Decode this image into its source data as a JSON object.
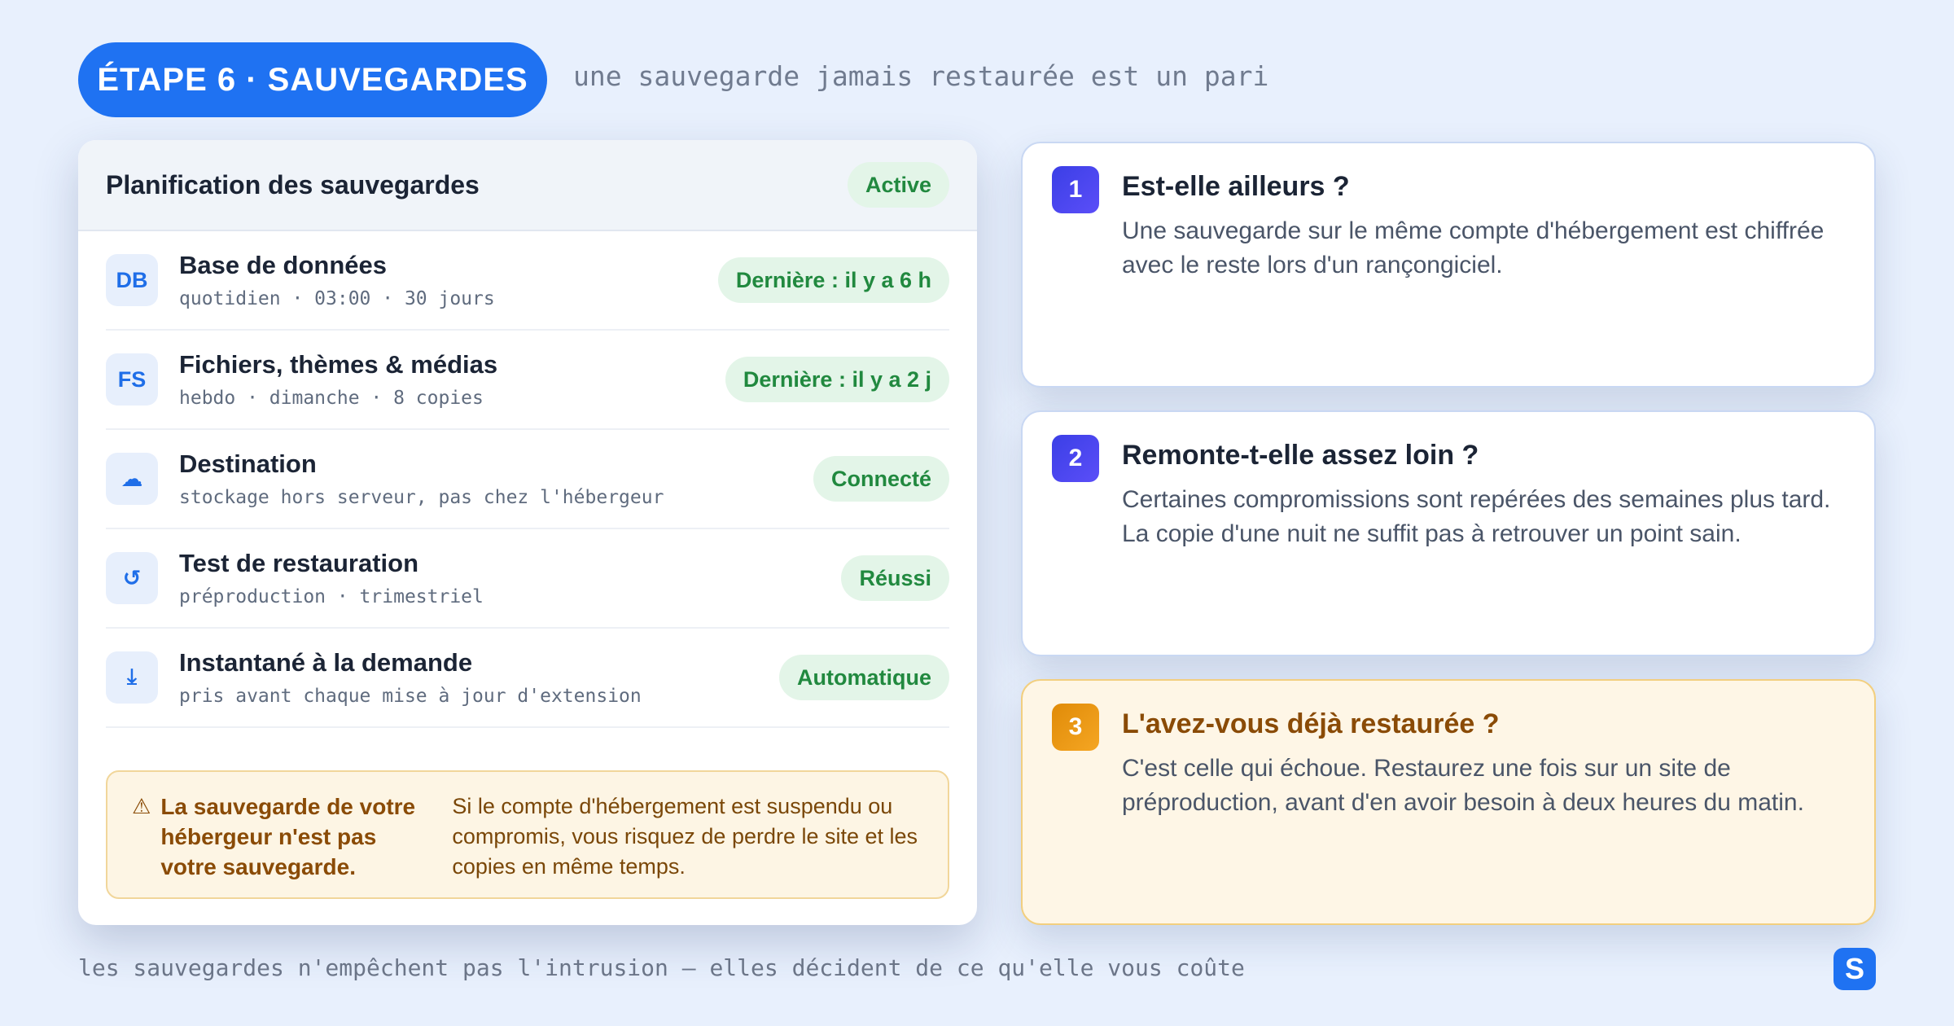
{
  "header": {
    "step_label": "ÉTAPE 6 · SAUVEGARDES",
    "tagline": "une sauvegarde jamais restaurée est un pari"
  },
  "schedule": {
    "title": "Planification des sauvegardes",
    "status": "Active",
    "rows": [
      {
        "icon": "DB",
        "icon_name": "database-icon",
        "title": "Base de données",
        "detail": "quotidien · 03:00 · 30 jours",
        "status": "Dernière : il y a 6 h"
      },
      {
        "icon": "FS",
        "icon_name": "files-icon",
        "title": "Fichiers, thèmes & médias",
        "detail": "hebdo · dimanche · 8 copies",
        "status": "Dernière : il y a 2 j"
      },
      {
        "icon": "☁",
        "icon_name": "cloud-icon",
        "title": "Destination",
        "detail": "stockage hors serveur, pas chez l'hébergeur",
        "status": "Connecté"
      },
      {
        "icon": "↺",
        "icon_name": "restore-icon",
        "title": "Test de restauration",
        "detail": "préproduction · trimestriel",
        "status": "Réussi"
      },
      {
        "icon": "⤓",
        "icon_name": "download-icon",
        "title": "Instantané à la demande",
        "detail": "pris avant chaque mise à jour d'extension",
        "status": "Automatique"
      }
    ],
    "warning": {
      "icon": "⚠",
      "title": "La sauvegarde de votre hébergeur n'est pas votre sauvegarde.",
      "body": "Si le compte d'hébergement est suspendu ou compromis, vous risquez de perdre le site et les copies en même temps."
    }
  },
  "questions": [
    {
      "number": "1",
      "title": "Est-elle ailleurs ?",
      "body": "Une sauvegarde sur le même compte d'hébergement est chiffrée avec le reste lors d'un rançongiciel."
    },
    {
      "number": "2",
      "title": "Remonte-t-elle assez loin ?",
      "body": "Certaines compromissions sont repérées des semaines plus tard. La copie d'une nuit ne suffit pas à retrouver un point sain."
    },
    {
      "number": "3",
      "title": "L'avez-vous déjà restaurée ?",
      "body": "C'est celle qui échoue. Restaurez une fois sur un site de préproduction, avant d'en avoir besoin à deux heures du matin."
    }
  ],
  "footer": {
    "text": "les sauvegardes n'empêchent pas l'intrusion — elles décident de ce qu'elle vous coûte",
    "logo_letter": "S"
  },
  "colors": {
    "accent": "#1f72f2",
    "success_bg": "#e3f5e8",
    "success_text": "#21893f",
    "warning_bg": "#fdf5e4",
    "warning_text": "#8a4b06"
  }
}
